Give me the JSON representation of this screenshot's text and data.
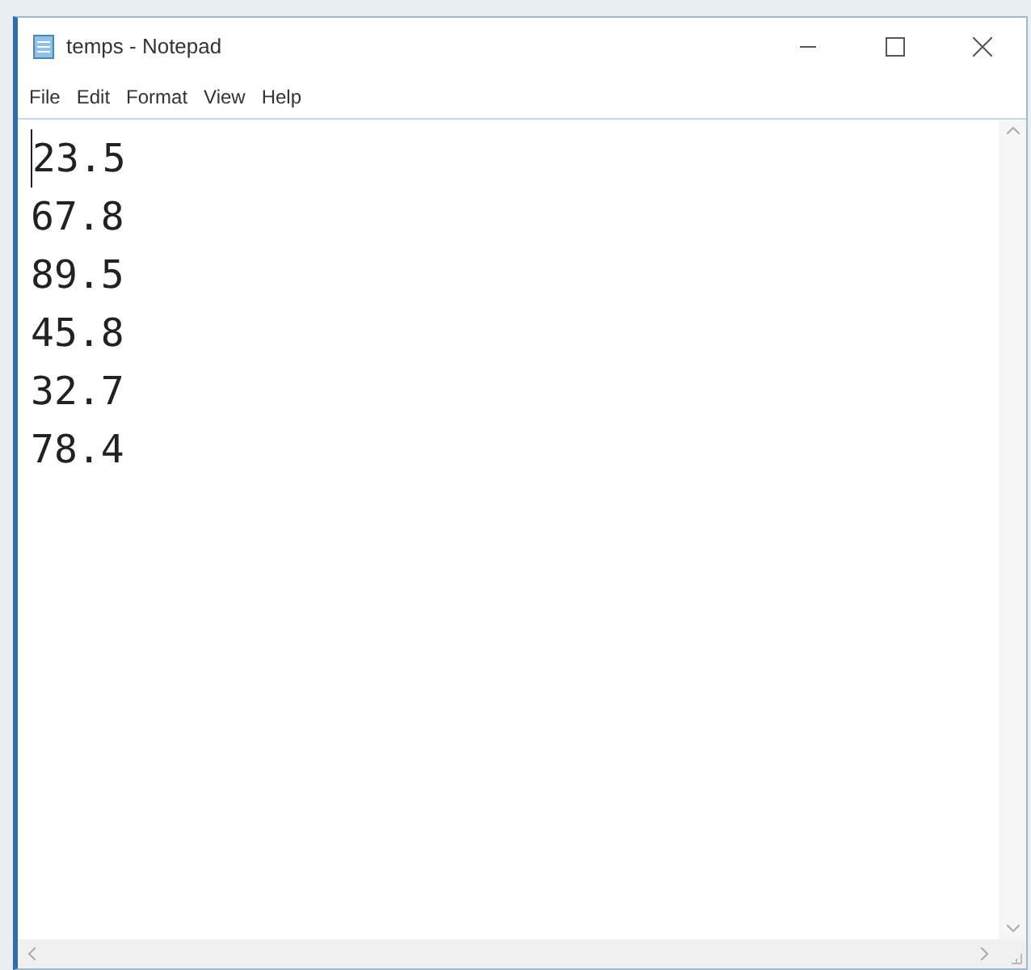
{
  "window": {
    "title": "temps - Notepad"
  },
  "menu": [
    "File",
    "Edit",
    "Format",
    "View",
    "Help"
  ],
  "document": {
    "lines": [
      "23.5",
      "67.8",
      "89.5",
      "45.8",
      "32.7",
      "78.4"
    ]
  }
}
